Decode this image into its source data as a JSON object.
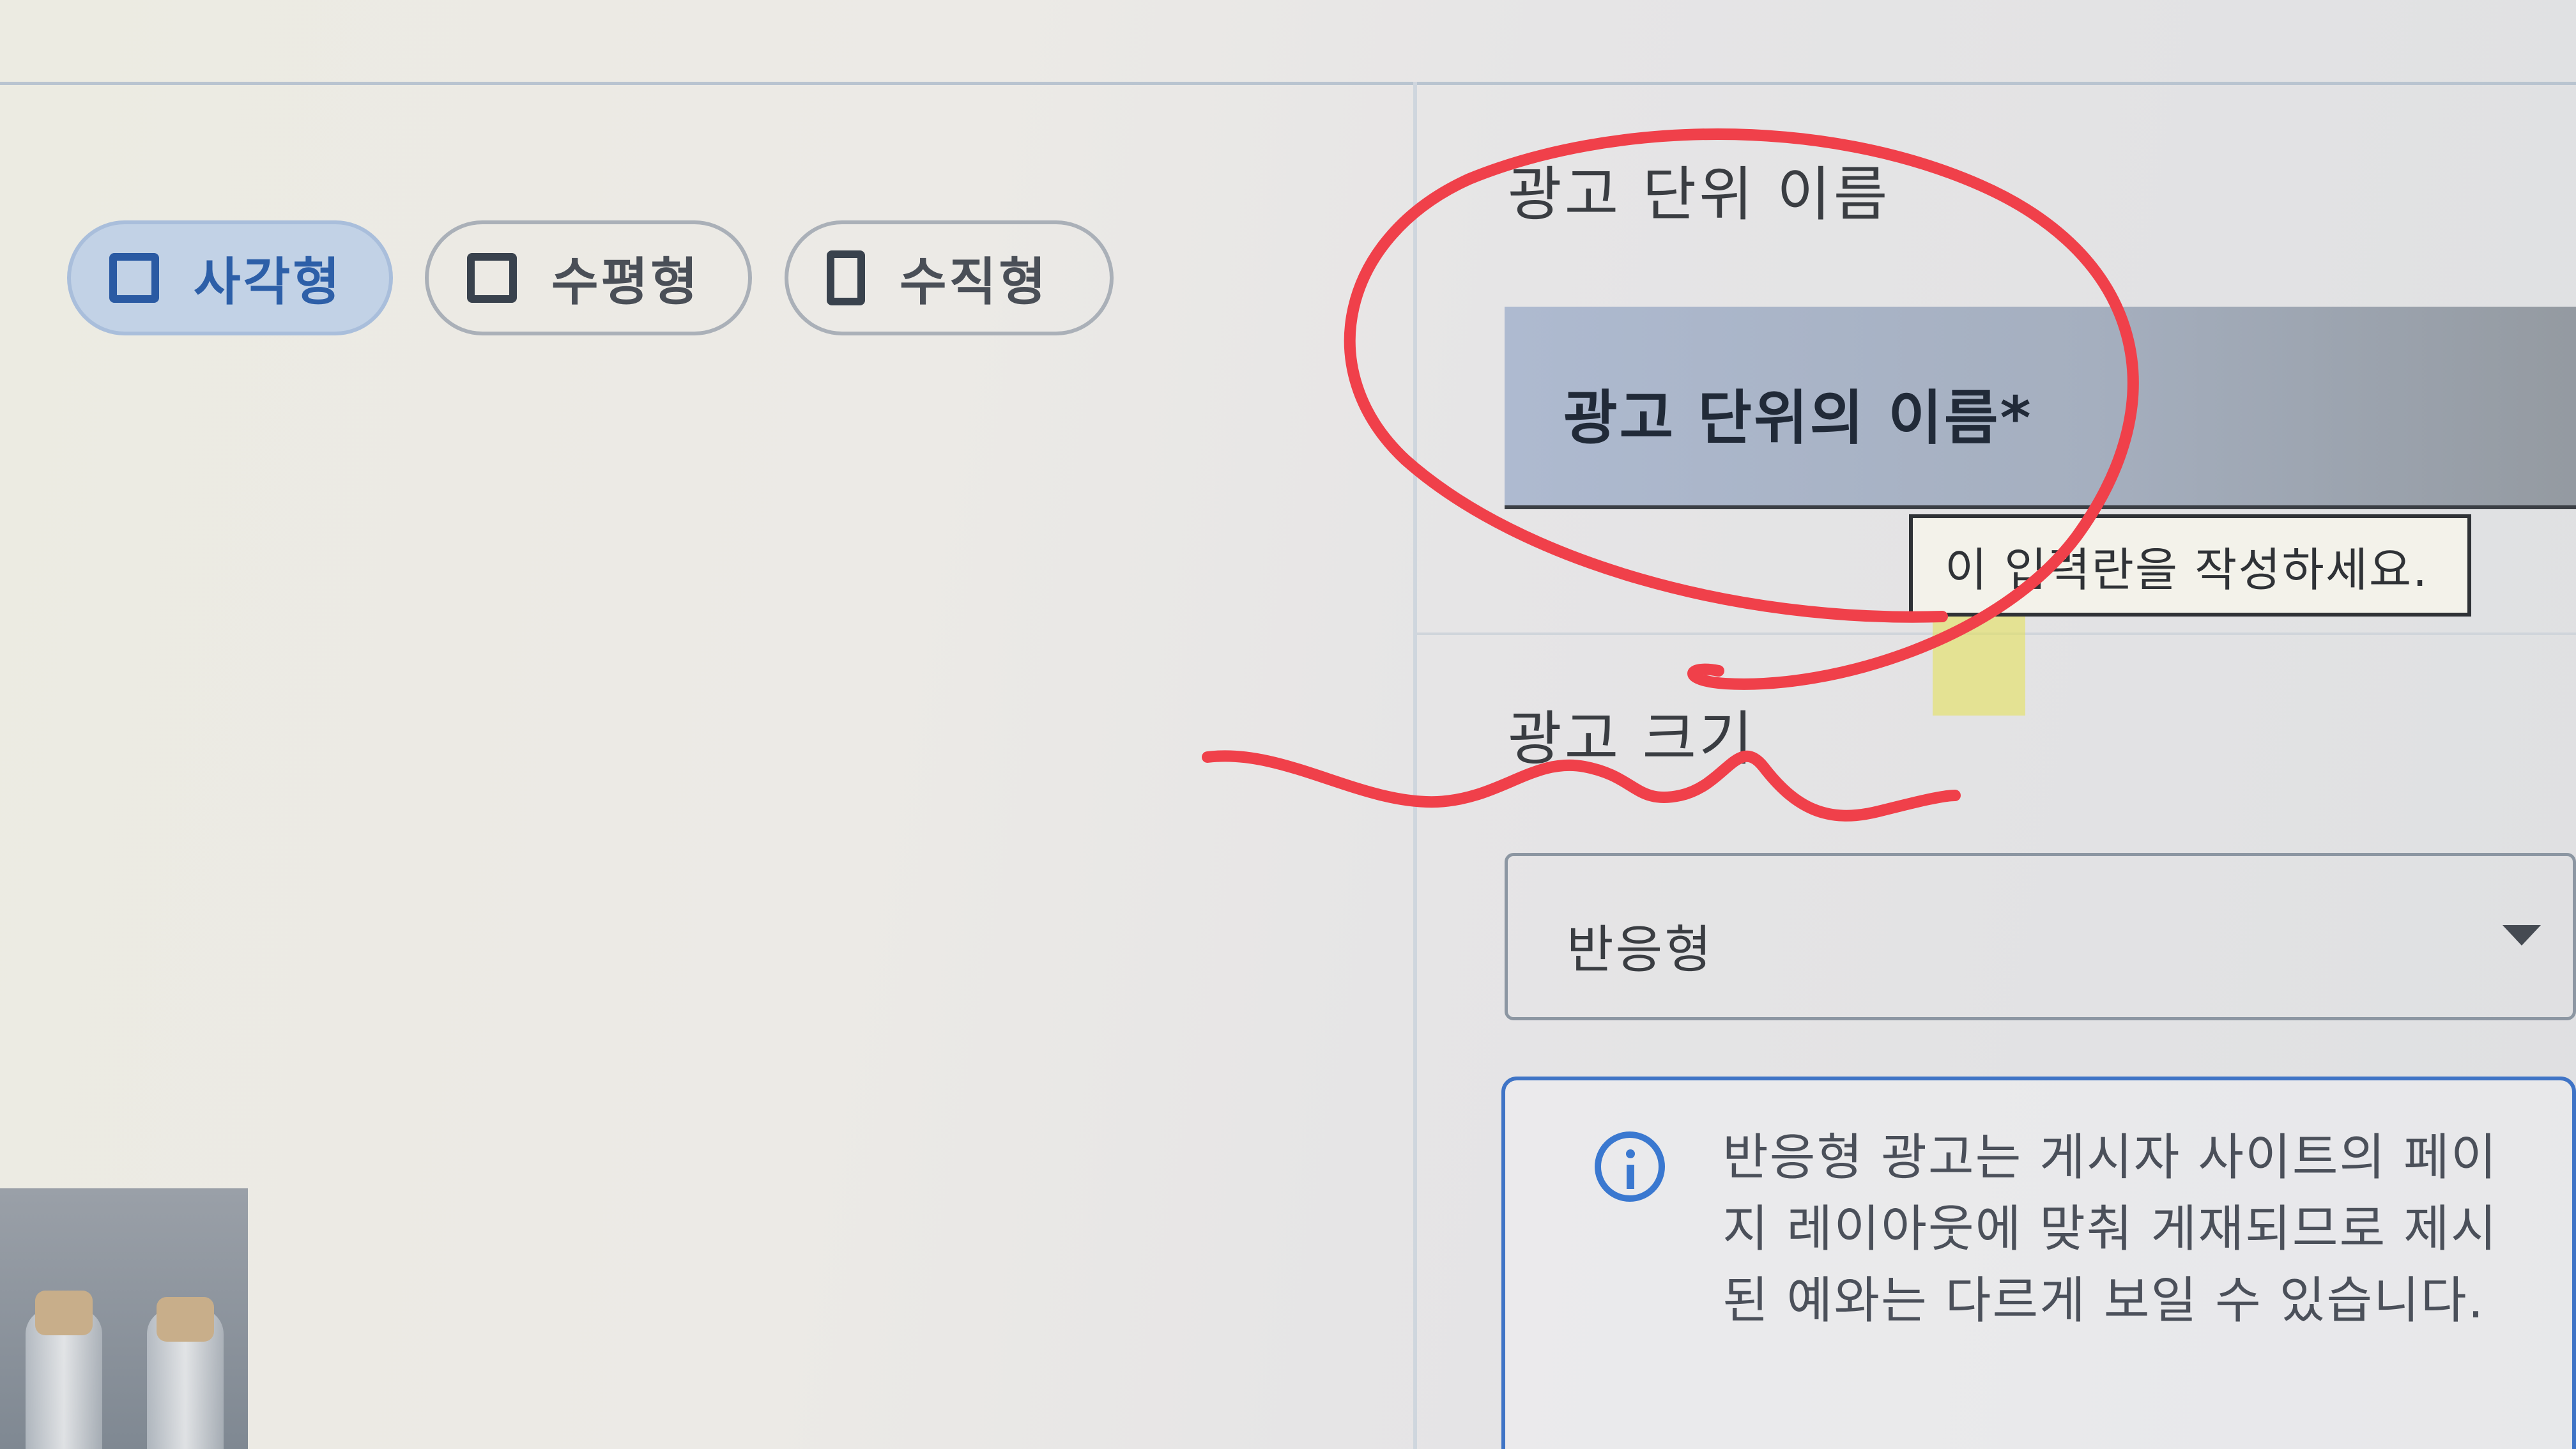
{
  "format_options": {
    "items": [
      {
        "label": "사각형",
        "icon": "square-icon",
        "selected": true
      },
      {
        "label": "수평형",
        "icon": "horizontal-rect-icon",
        "selected": false
      },
      {
        "label": "수직형",
        "icon": "vertical-rect-icon",
        "selected": false
      }
    ]
  },
  "ad_unit_name": {
    "label": "광고 단위 이름",
    "placeholder": "광고 단위의 이름*",
    "validation_tooltip": "이 입력란을 작성하세요."
  },
  "ad_size": {
    "label": "광고 크기",
    "selected_value": "반응형",
    "dropdown_icon": "caret-down-icon"
  },
  "info_notice": {
    "icon": "info-icon",
    "text": "반응형 광고는 게시자 사이트의 페이지 레이아웃에 맞춰 게재되므로 제시된 예와는 다르게 보일 수 있습니다."
  },
  "colors": {
    "accent": "#2d5fa8",
    "selected_chip_bg": "#c2d2e6",
    "info_border": "#3f74c6",
    "markup_red": "#f0404a"
  }
}
